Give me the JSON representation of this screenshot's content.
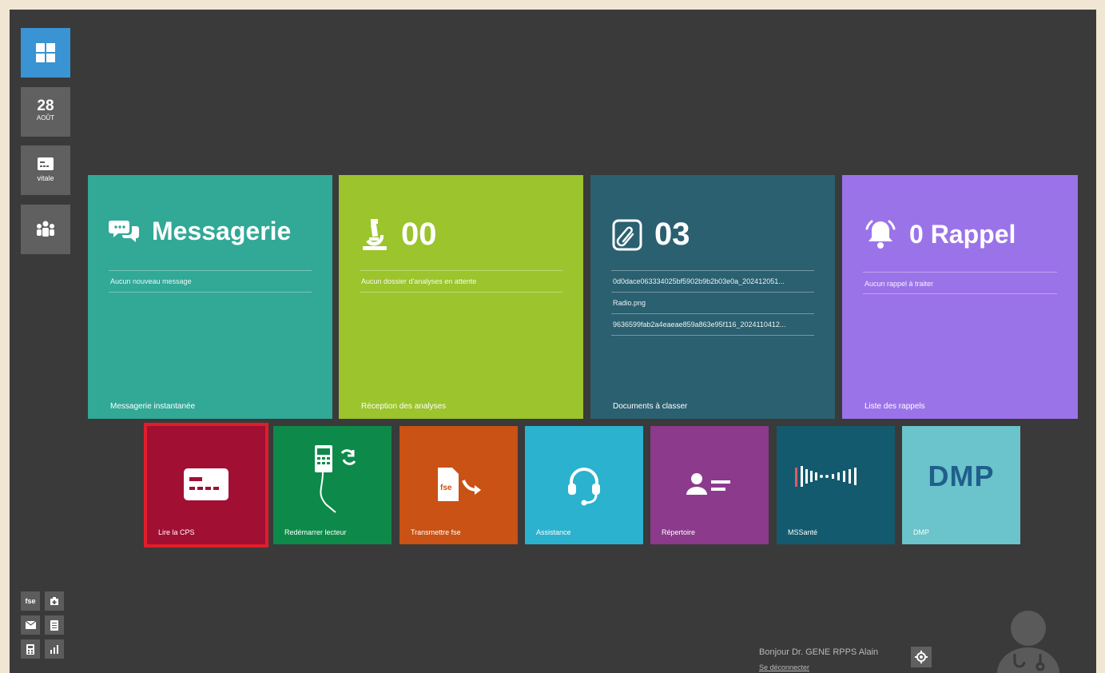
{
  "rail": {
    "date_day": "28",
    "date_month": "AOÛT",
    "vitale_label": "vitale"
  },
  "tiles": {
    "messagerie": {
      "title": "Messagerie",
      "line1": "Aucun nouveau message",
      "footer": "Messagerie instantanée",
      "color": "#32a897"
    },
    "analyses": {
      "count": "00",
      "line1": "Aucun dossier d'analyses en attente",
      "footer": "Réception des analyses",
      "color": "#9bc42d"
    },
    "documents": {
      "count": "03",
      "items": [
        "0d0dace063334025bf5902b9b2b03e0a_202412051...",
        "Radio.png",
        "9636599fab2a4eaeae859a863e95f116_2024110412..."
      ],
      "footer": "Documents à classer",
      "color": "#2a6070"
    },
    "rappels": {
      "title": "0 Rappel",
      "line1": "Aucun rappel à traiter",
      "footer": "Liste des rappels",
      "color": "#9b73e9"
    }
  },
  "shortcuts": [
    {
      "label": "Lire la CPS",
      "color": "#a10f33"
    },
    {
      "label": "Redémarrer lecteur",
      "color": "#0d8a4a"
    },
    {
      "label": "Transmettre fse",
      "color": "#c95214"
    },
    {
      "label": "Assistance",
      "color": "#2ab2cf"
    },
    {
      "label": "Répertoire",
      "color": "#8b3a8c"
    },
    {
      "label": "MSSanté",
      "color": "#135a6e"
    },
    {
      "label": "DMP",
      "color": "#6bc3cb",
      "logo_text": "DMP"
    }
  ],
  "mini_buttons": {
    "fse": "fse"
  },
  "footer": {
    "greeting": "Bonjour Dr. GENE RPPS Alain",
    "logout": "Se déconnecter"
  }
}
